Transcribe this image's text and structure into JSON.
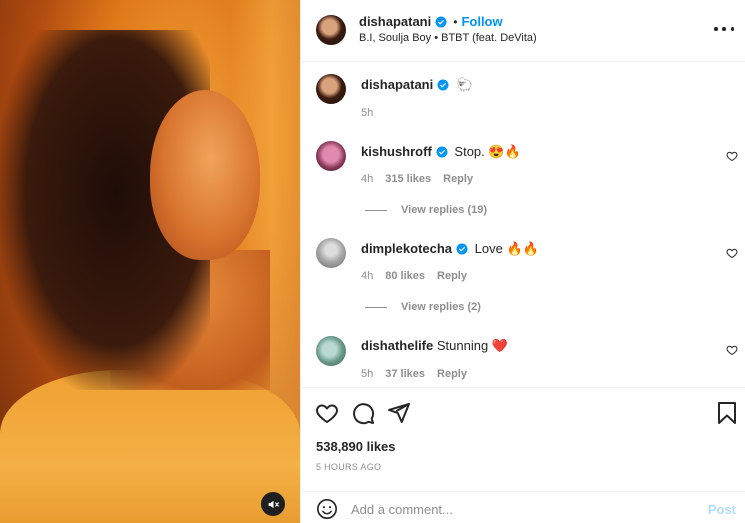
{
  "post": {
    "author": "dishapatani",
    "follow_label": "Follow",
    "separator": "•",
    "audio": "B.I, Soulja Boy • BTBT (feat. DeVita)",
    "caption_emoji": "🐑",
    "caption_time": "5h",
    "likes": "538,890 likes",
    "posted_ago": "5 HOURS AGO"
  },
  "comments": [
    {
      "username": "kishushroff",
      "verified": true,
      "text": "Stop. 😍🔥",
      "time": "4h",
      "likes": "315 likes",
      "reply_label": "Reply",
      "view_replies": "View replies (19)"
    },
    {
      "username": "dimplekotecha",
      "verified": true,
      "text": "Love 🔥🔥",
      "time": "4h",
      "likes": "80 likes",
      "reply_label": "Reply",
      "view_replies": "View replies (2)"
    },
    {
      "username": "dishathelife",
      "verified": false,
      "text": "Stunning ❤️",
      "time": "5h",
      "likes": "37 likes",
      "reply_label": "Reply"
    }
  ],
  "composer": {
    "placeholder": "Add a comment...",
    "post_label": "Post"
  },
  "colors": {
    "accent": "#0095f6",
    "muted": "#8e8e8e",
    "post_disabled": "#b2dffc"
  },
  "icons": [
    "mute-icon",
    "more-icon",
    "verified-icon",
    "heart-icon",
    "comment-icon",
    "share-icon",
    "bookmark-icon",
    "emoji-icon"
  ]
}
